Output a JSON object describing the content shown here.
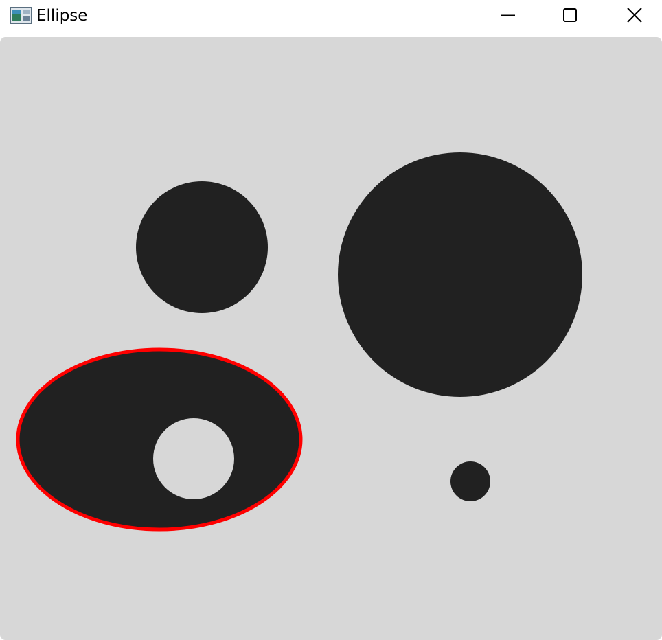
{
  "window": {
    "title": "Ellipse",
    "icon": "image-viewer-app-icon",
    "controls": [
      "minimize-icon",
      "maximize-icon",
      "close-icon"
    ]
  },
  "canvas": {
    "background_color": "#d7d7d7",
    "shape_color": "#212121",
    "highlight_color": "#ff0000",
    "shapes": [
      {
        "kind": "circle",
        "name": "medium-circle"
      },
      {
        "kind": "circle",
        "name": "large-circle"
      },
      {
        "kind": "ellipse-with-hole",
        "name": "ellipse-with-hole",
        "highlighted": true
      },
      {
        "kind": "circle",
        "name": "small-circle"
      }
    ]
  }
}
